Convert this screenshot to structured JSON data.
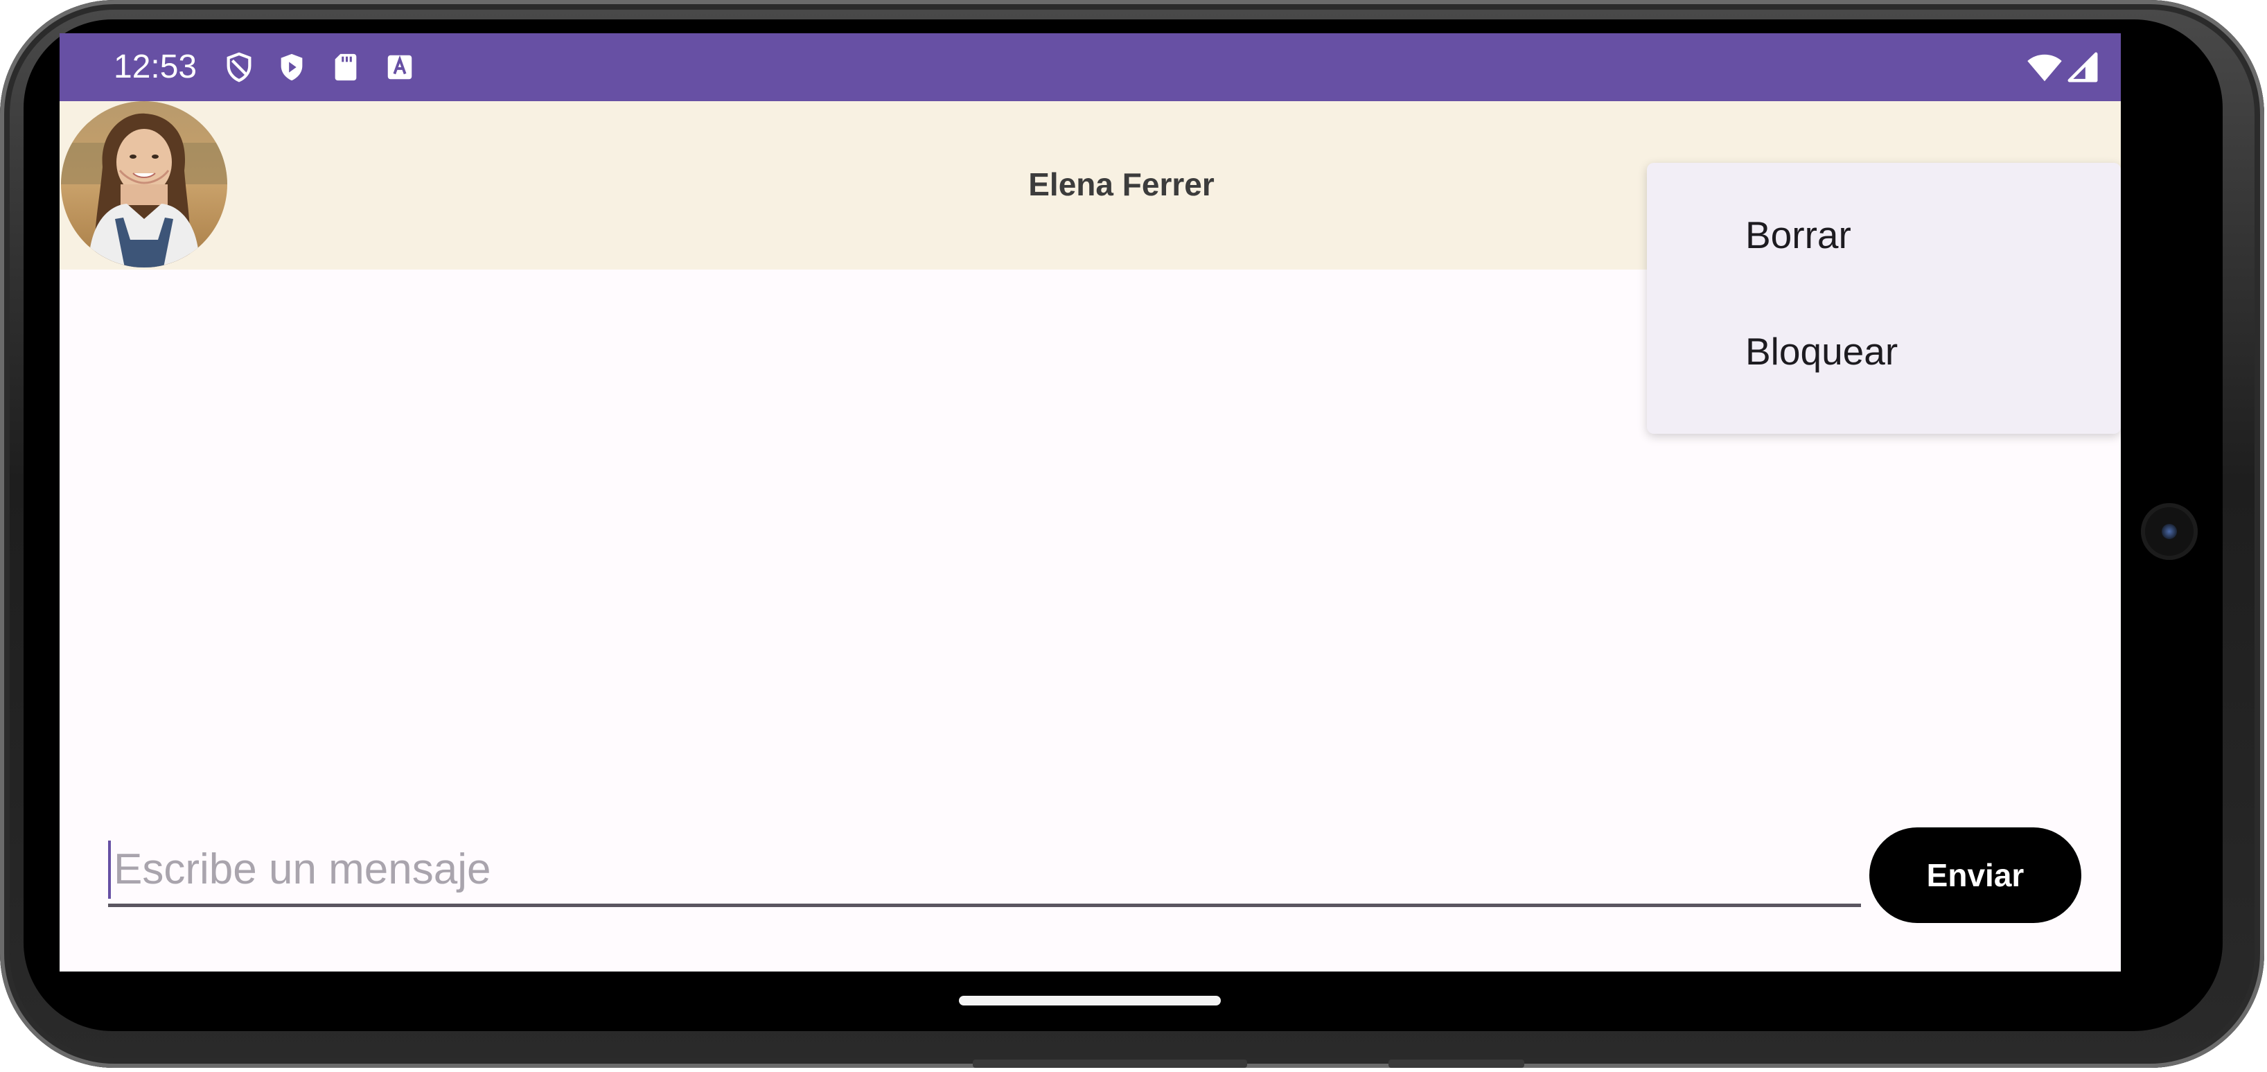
{
  "status_bar": {
    "time": "12:53",
    "left_icons": [
      "shield-icon",
      "play-protect-icon",
      "sd-card-icon",
      "font-a-icon"
    ],
    "right_icons": [
      "wifi-icon",
      "signal-icon"
    ],
    "background": "#6750a4"
  },
  "chat_header": {
    "contact_name": "Elena Ferrer",
    "avatar": "avatar",
    "background": "#f8f1e2"
  },
  "menu": {
    "items": [
      {
        "label": "Borrar"
      },
      {
        "label": "Bloquear"
      }
    ]
  },
  "composer": {
    "placeholder": "Escribe un mensaje",
    "value": "",
    "send_label": "Enviar"
  },
  "colors": {
    "accent": "#6750a4",
    "screen_background": "#fffbfe",
    "menu_background": "#f2eef6",
    "send_button": "#000000"
  }
}
